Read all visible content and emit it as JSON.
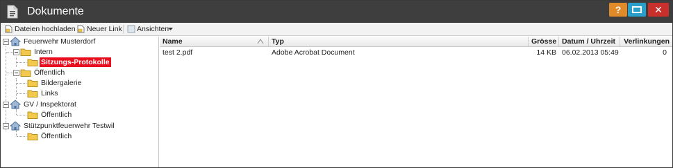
{
  "window": {
    "title": "Dokumente",
    "buttons": {
      "help": "?",
      "close": "✕"
    }
  },
  "toolbar": {
    "upload_label": "Dateien hochladen",
    "new_link_label": "Neuer Link",
    "views_label": "Ansichten"
  },
  "tree": {
    "root1": {
      "label": "Feuerwehr Musterdorf"
    },
    "intern": {
      "label": "Intern"
    },
    "sitzungs": {
      "label": "Sitzungs-Protokolle"
    },
    "oeffentlich1": {
      "label": "Öffentlich"
    },
    "bildergalerie": {
      "label": "Bildergalerie"
    },
    "links": {
      "label": "Links"
    },
    "root2": {
      "label": "GV / Inspektorat"
    },
    "oeffentlich2": {
      "label": "Öffentlich"
    },
    "root3": {
      "label": "Stützpunktfeuerwehr Testwil"
    },
    "oeffentlich3": {
      "label": "Öffentlich"
    }
  },
  "grid": {
    "columns": [
      "Name",
      "Typ",
      "Grösse",
      "Datum / Uhrzeit",
      "Verlinkungen"
    ],
    "rows": [
      [
        "test 2.pdf",
        "Adobe Acrobat Document",
        "14 KB",
        "06.02.2013 05:49",
        "0"
      ]
    ]
  },
  "colors": {
    "titlebar": "#3e3e3e",
    "help_button": "#e08a2a",
    "maximize_button": "#2a9fc9",
    "close_button": "#c9302c",
    "selection": "#e8101e",
    "folder": "#f2c94c"
  },
  "icons": {
    "title": "document-icon",
    "upload": "upload-icon",
    "new_link": "new-link-icon",
    "views": "view-icon",
    "root": "home-icon",
    "folder": "folder-icon"
  }
}
